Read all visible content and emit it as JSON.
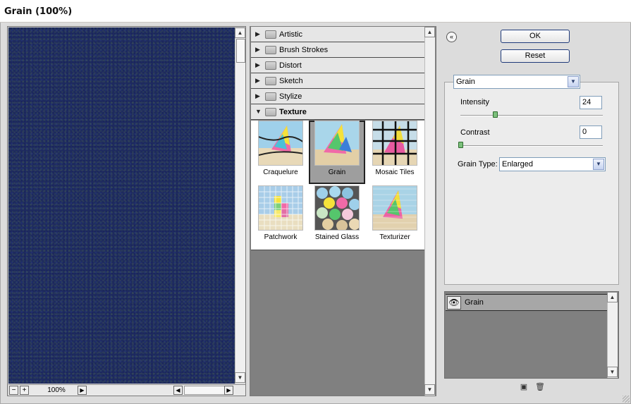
{
  "window": {
    "title": "Grain (100%)"
  },
  "preview": {
    "zoom": "100%",
    "minus": "−",
    "plus": "+"
  },
  "categories": [
    {
      "label": "Artistic",
      "arrow": "▶"
    },
    {
      "label": "Brush Strokes",
      "arrow": "▶"
    },
    {
      "label": "Distort",
      "arrow": "▶"
    },
    {
      "label": "Sketch",
      "arrow": "▶"
    },
    {
      "label": "Stylize",
      "arrow": "▶"
    },
    {
      "label": "Texture",
      "arrow": "▼"
    }
  ],
  "filters": [
    {
      "name": "Craquelure",
      "selected": false
    },
    {
      "name": "Grain",
      "selected": true
    },
    {
      "name": "Mosaic Tiles",
      "selected": false
    },
    {
      "name": "Patchwork",
      "selected": false
    },
    {
      "name": "Stained Glass",
      "selected": false
    },
    {
      "name": "Texturizer",
      "selected": false
    }
  ],
  "buttons": {
    "ok": "OK",
    "reset": "Reset",
    "collapse": "«"
  },
  "settings": {
    "filter_select": "Grain",
    "intensity_label": "Intensity",
    "intensity_value": "24",
    "contrast_label": "Contrast",
    "contrast_value": "0",
    "grain_type_label": "Grain Type:",
    "grain_type_value": "Enlarged"
  },
  "layers": {
    "layer_name": "Grain",
    "eye": "👁"
  },
  "colors": {
    "preview_base": "#1e2a5f",
    "selection": "#9e9e9e",
    "button_border": "#1f3a7a"
  }
}
